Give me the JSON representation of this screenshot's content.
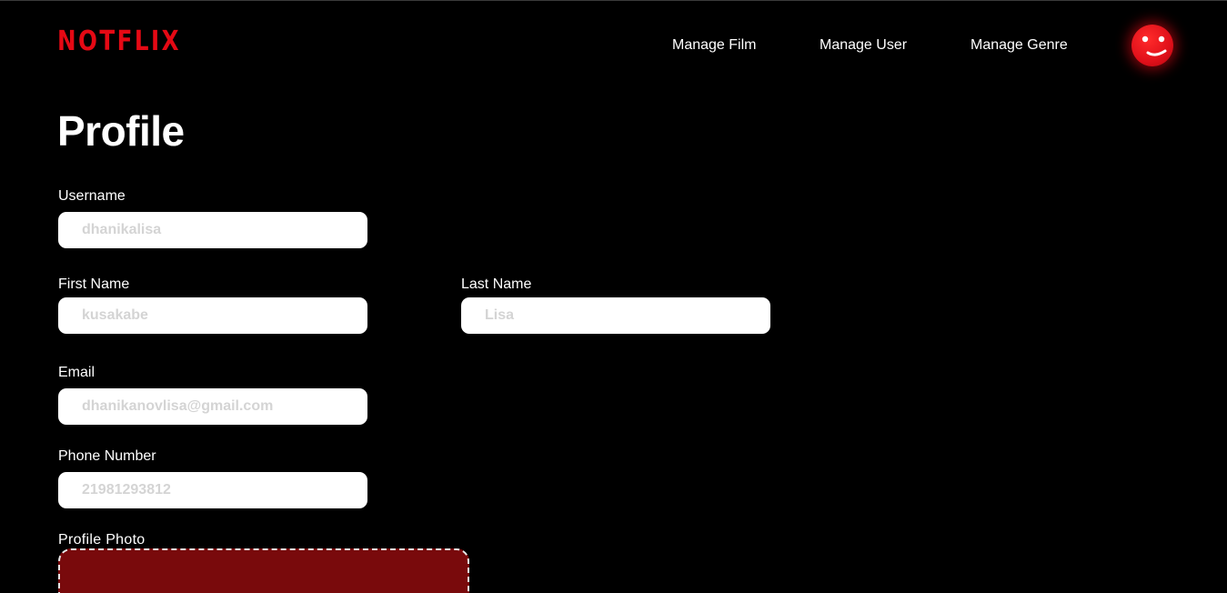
{
  "header": {
    "logo_text": "NOTFLIX",
    "nav": {
      "manage_film": "Manage Film",
      "manage_user": "Manage User",
      "manage_genre": "Manage Genre"
    },
    "avatar_icon": "smiley-face-icon"
  },
  "page": {
    "title": "Profile"
  },
  "form": {
    "username": {
      "label": "Username",
      "placeholder": "dhanikalisa",
      "value": ""
    },
    "first_name": {
      "label": "First Name",
      "placeholder": "kusakabe",
      "value": ""
    },
    "last_name": {
      "label": "Last Name",
      "placeholder": "Lisa",
      "value": ""
    },
    "email": {
      "label": "Email",
      "placeholder": "dhanikanovlisa@gmail.com",
      "value": ""
    },
    "phone": {
      "label": "Phone Number",
      "placeholder": "21981293812",
      "value": ""
    },
    "profile_photo": {
      "label": "Profile Photo"
    }
  },
  "colors": {
    "brand_red": "#e50914",
    "background": "#000000",
    "upload_area": "#790a0c",
    "input_background": "#ffffff",
    "placeholder": "#d4d4d4"
  }
}
